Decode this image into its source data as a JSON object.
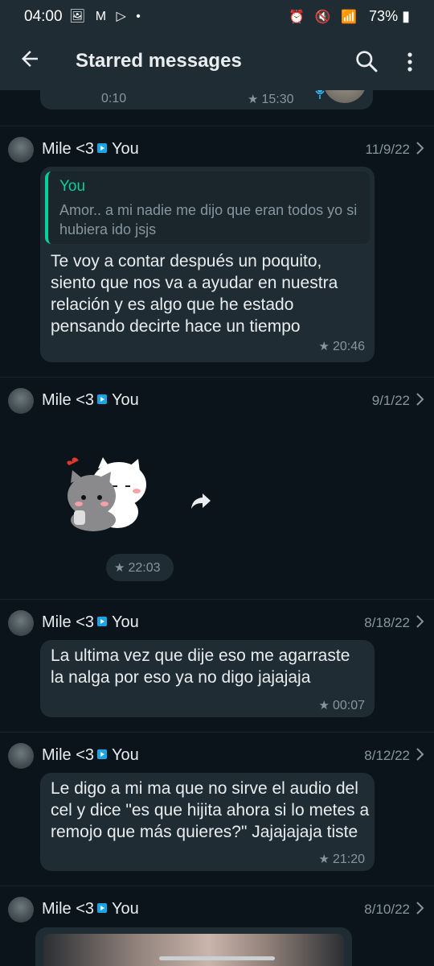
{
  "status_bar": {
    "time": "04:00",
    "notif_icons": "🖼 M ▷ •",
    "right_icons": "⏰ 🔇 📶",
    "battery": "73%"
  },
  "app_bar": {
    "title": "Starred messages"
  },
  "partial_message": {
    "duration": "0:10",
    "time": "15:30"
  },
  "messages": [
    {
      "sender": "Mile <3",
      "recipient": "You",
      "date": "11/9/22",
      "quote_author": "You",
      "quote_text": "Amor.. a mi nadie me dijo que eran todos yo si hubiera ido jsjs",
      "text": "Te voy a contar después un poquito, siento que nos va a ayudar en nuestra relación y es algo que he estado pensando decirte hace un tiempo",
      "time": "20:46"
    },
    {
      "sender": "Mile <3",
      "recipient": "You",
      "date": "9/1/22",
      "type": "sticker",
      "time": "22:03"
    },
    {
      "sender": "Mile <3",
      "recipient": "You",
      "date": "8/18/22",
      "text": "La ultima vez que dije eso me agarraste la nalga por eso ya no digo jajajaja",
      "time": "00:07"
    },
    {
      "sender": "Mile <3",
      "recipient": "You",
      "date": "8/12/22",
      "text": "Le digo a mi ma que no sirve el audio del cel y dice \"es que hijita ahora si lo metes a remojo que más quieres?\" Jajajajaja tiste",
      "time": "21:20"
    },
    {
      "sender": "Mile <3",
      "recipient": "You",
      "date": "8/10/22",
      "type": "photo"
    }
  ],
  "colors": {
    "background": "#0b141a",
    "bar": "#1f2c34",
    "bubble": "#1f2c34",
    "accent": "#06cf9c",
    "muted": "#8696a0"
  },
  "icons": [
    "back-arrow-icon",
    "search-icon",
    "more-vert-icon",
    "star-icon",
    "chevron-right-icon",
    "forward-icon",
    "mic-icon",
    "sent-to-icon"
  ]
}
